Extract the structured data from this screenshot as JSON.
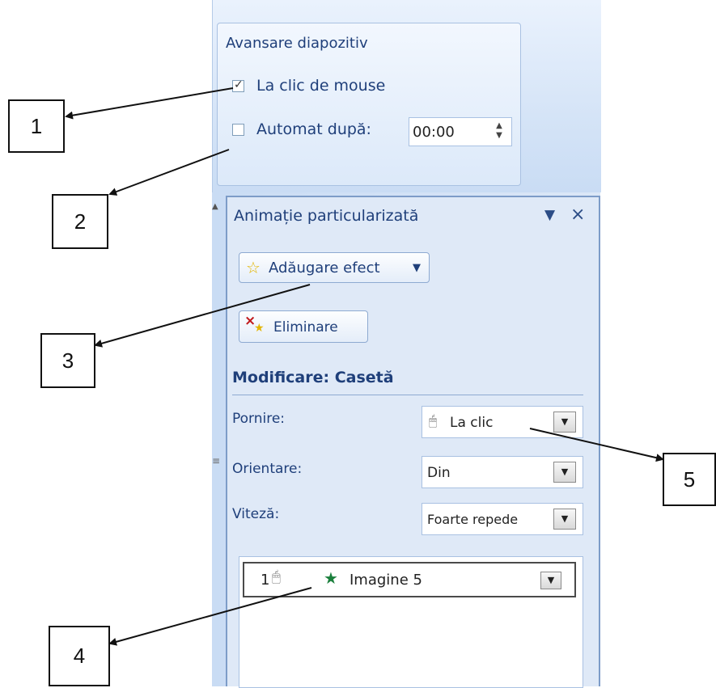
{
  "ribbon": {
    "group_title": "Avansare diapozitiv",
    "on_click": {
      "label": "La clic de mouse",
      "checked": true
    },
    "automatic": {
      "label": "Automat după:",
      "checked": false,
      "value": "00:00"
    }
  },
  "pane": {
    "title": "Animație particularizată",
    "dropdown_icon": "triangle-down-icon",
    "close_icon": "close-icon",
    "add_effect_label": "Adăugare efect",
    "remove_label": "Eliminare",
    "modify_header": "Modificare: Casetă",
    "start": {
      "label": "Pornire:",
      "value": "La clic"
    },
    "direction": {
      "label": "Orientare:",
      "value": "Din"
    },
    "speed": {
      "label": "Viteză:",
      "value": "Foarte repede"
    },
    "list_items": [
      {
        "number": "1",
        "label": "Imagine 5"
      }
    ]
  },
  "callouts": [
    "1",
    "2",
    "3",
    "4",
    "5"
  ],
  "colors": {
    "accent_text": "#1f3f7a",
    "pane_background": "#dfe9f7",
    "pane_border": "#7d9cc8"
  }
}
